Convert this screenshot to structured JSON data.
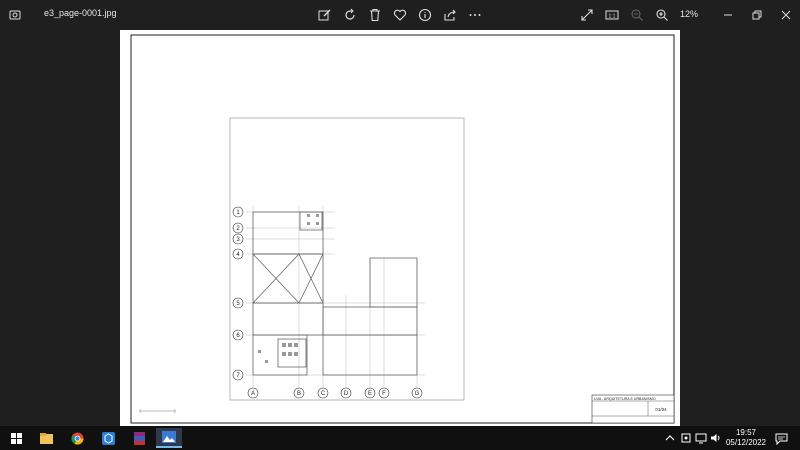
{
  "window": {
    "file_name": "e3_page-0001.jpg",
    "zoom": "12%",
    "toolbar_icons": [
      "edit-image-icon",
      "rotate-icon",
      "delete-icon",
      "favorite-icon",
      "info-icon",
      "share-icon",
      "more-icon"
    ],
    "right_icons": [
      "fullscreen-icon",
      "actual-size-icon",
      "zoom-out-icon",
      "zoom-in-icon"
    ],
    "actual_size_label": "1:1"
  },
  "drawing": {
    "grid_rows": [
      "1",
      "2",
      "3",
      "4",
      "5",
      "6",
      "7"
    ],
    "grid_cols": [
      "A",
      "B",
      "C",
      "D",
      "E",
      "F",
      "G"
    ],
    "title_block": {
      "line1": "UVA - ARQUITETURA E URBANISMO",
      "sheet": "01/04"
    }
  },
  "taskbar": {
    "apps": [
      "start-icon",
      "file-explorer-icon",
      "chrome-icon",
      "app-icon",
      "winrar-icon",
      "photos-icon"
    ],
    "time": "19:57",
    "date": "05/12/2022"
  }
}
